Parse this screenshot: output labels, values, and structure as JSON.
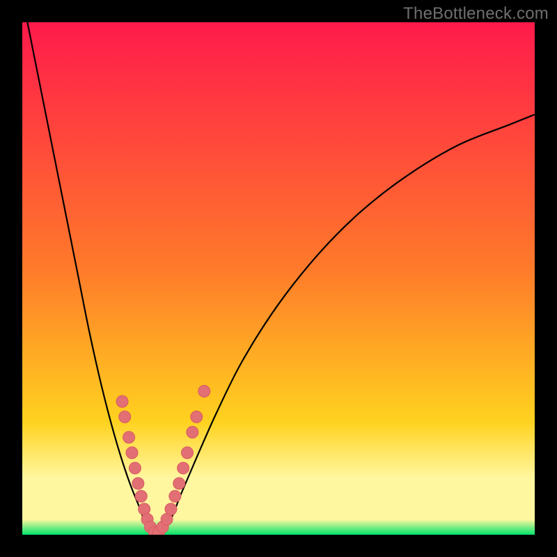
{
  "watermark": "TheBottleneck.com",
  "colors": {
    "frame": "#000000",
    "grad_top": "#ff1a4b",
    "grad_mid1": "#ff7a2a",
    "grad_mid2": "#ffd21f",
    "grad_band": "#fff7a0",
    "grad_green": "#00e36b",
    "curve": "#000000",
    "marker_fill": "#e26f74",
    "marker_stroke": "#d85a61"
  },
  "chart_data": {
    "type": "line",
    "title": "",
    "xlabel": "",
    "ylabel": "",
    "xlim": [
      0,
      100
    ],
    "ylim": [
      0,
      100
    ],
    "series": [
      {
        "name": "bottleneck-curve-left",
        "x": [
          1,
          3,
          5,
          7,
          9,
          11,
          13,
          15,
          17,
          19,
          21,
          23,
          24,
          25
        ],
        "values": [
          100,
          90,
          80,
          70,
          60,
          50,
          40,
          31,
          23,
          16,
          10,
          5,
          2,
          0
        ]
      },
      {
        "name": "bottleneck-valley-flat",
        "x": [
          25,
          26,
          27
        ],
        "values": [
          0,
          0,
          0
        ]
      },
      {
        "name": "bottleneck-curve-right",
        "x": [
          27,
          29,
          31,
          34,
          38,
          43,
          50,
          58,
          66,
          75,
          85,
          95,
          100
        ],
        "values": [
          0,
          3,
          8,
          15,
          24,
          34,
          45,
          55,
          63,
          70,
          76,
          80,
          82
        ]
      }
    ],
    "markers": {
      "name": "highlighted-points",
      "points": [
        {
          "x": 19.5,
          "y": 26
        },
        {
          "x": 20.0,
          "y": 23
        },
        {
          "x": 20.8,
          "y": 19
        },
        {
          "x": 21.4,
          "y": 16
        },
        {
          "x": 22.0,
          "y": 13
        },
        {
          "x": 22.6,
          "y": 10
        },
        {
          "x": 23.2,
          "y": 7.5
        },
        {
          "x": 23.8,
          "y": 5
        },
        {
          "x": 24.4,
          "y": 3
        },
        {
          "x": 25.0,
          "y": 1.5
        },
        {
          "x": 25.8,
          "y": 0.5
        },
        {
          "x": 26.6,
          "y": 0.5
        },
        {
          "x": 27.4,
          "y": 1.5
        },
        {
          "x": 28.2,
          "y": 3
        },
        {
          "x": 29.0,
          "y": 5
        },
        {
          "x": 29.8,
          "y": 7.5
        },
        {
          "x": 30.6,
          "y": 10
        },
        {
          "x": 31.4,
          "y": 13
        },
        {
          "x": 32.2,
          "y": 16
        },
        {
          "x": 33.2,
          "y": 20
        },
        {
          "x": 34.0,
          "y": 23
        },
        {
          "x": 35.5,
          "y": 28
        }
      ]
    },
    "gradient_bands": [
      {
        "y": 100,
        "color": "#ff1a4b"
      },
      {
        "y": 50,
        "color": "#ff9a2a"
      },
      {
        "y": 25,
        "color": "#ffe21f"
      },
      {
        "y": 12,
        "color": "#fff7a0"
      },
      {
        "y": 2,
        "color": "#00e36b"
      }
    ]
  }
}
